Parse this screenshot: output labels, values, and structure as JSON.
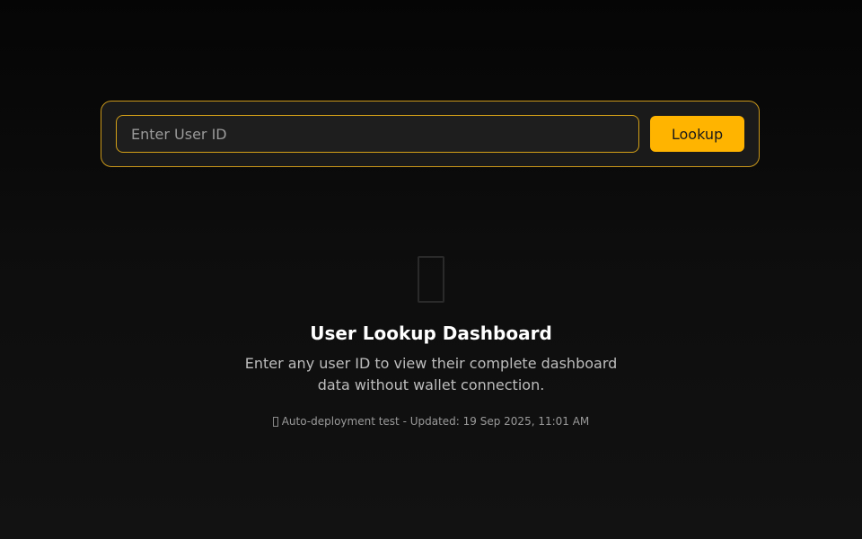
{
  "search": {
    "placeholder": "Enter User ID",
    "value": "",
    "button_label": "Lookup"
  },
  "empty_state": {
    "icon": "missing-glyph-icon",
    "title": "User Lookup Dashboard",
    "description": "Enter any user ID to view their complete dashboard data without wallet connection.",
    "status_icon": "missing-glyph-icon",
    "status_text": "Auto-deployment test - Updated: 19 Sep 2025, 11:01 AM"
  },
  "colors": {
    "accent": "#ffb400",
    "border": "#d4a017",
    "background": "#0d0d0d"
  }
}
